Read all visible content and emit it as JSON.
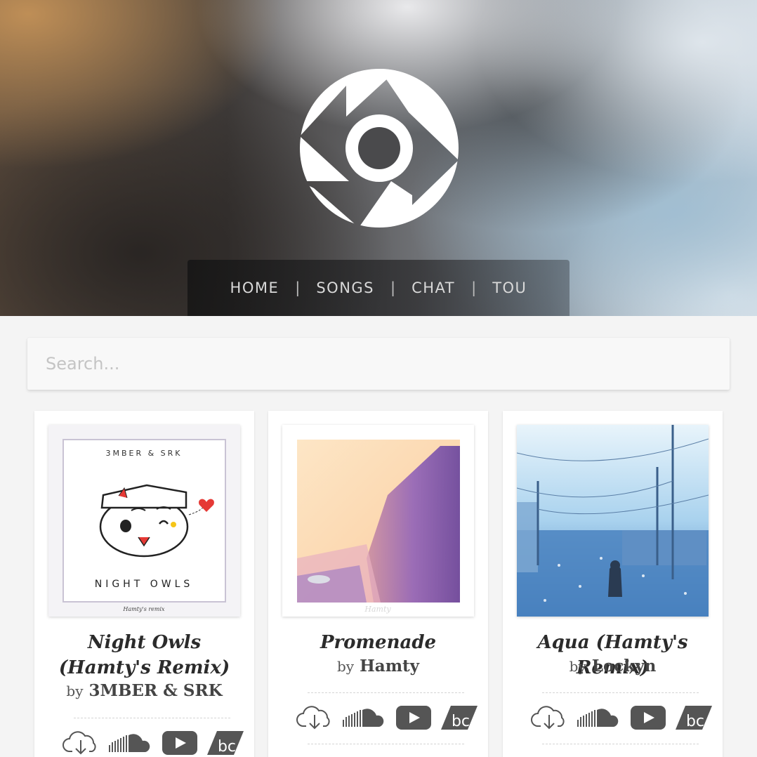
{
  "nav": {
    "items": [
      {
        "label": "HOME"
      },
      {
        "label": "SONGS"
      },
      {
        "label": "CHAT"
      },
      {
        "label": "TOU"
      }
    ],
    "separator": "|"
  },
  "search": {
    "placeholder": "Search..."
  },
  "songs": [
    {
      "title": "Night Owls (Hamty's Remix)",
      "by": "by",
      "artist": "3MBER & SRK",
      "cover": {
        "top_text": "3MBER & SRK",
        "bottom_text": "NIGHT OWLS",
        "credit": "Hamty's remix"
      }
    },
    {
      "title": "Promenade",
      "by": "by",
      "artist": "Hamty",
      "cover": {
        "credit": "Hamty"
      }
    },
    {
      "title": "Aqua (Hamty's Remix)",
      "by": "by",
      "artist": "Lockyn",
      "cover": {}
    }
  ],
  "link_icons": [
    "download-cloud-icon",
    "soundcloud-icon",
    "youtube-icon",
    "bandcamp-icon"
  ]
}
